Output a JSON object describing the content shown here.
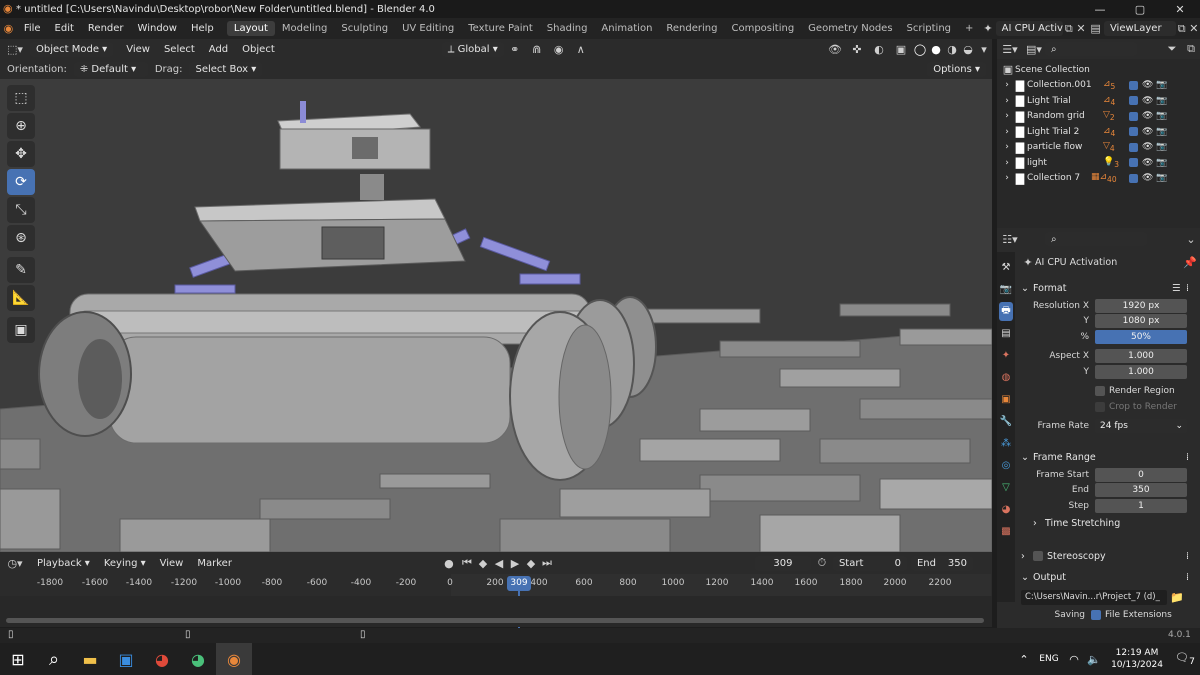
{
  "window": {
    "title": "* untitled [C:\\Users\\Navindu\\Desktop\\robor\\New Folder\\untitled.blend] - Blender 4.0",
    "controls": [
      "—",
      "▢",
      "✕"
    ]
  },
  "menu": {
    "items": [
      "File",
      "Edit",
      "Render",
      "Window",
      "Help"
    ],
    "workspaces": [
      "Layout",
      "Modeling",
      "Sculpting",
      "UV Editing",
      "Texture Paint",
      "Shading",
      "Animation",
      "Rendering",
      "Compositing",
      "Geometry Nodes",
      "Scripting"
    ],
    "active_workspace": "Layout",
    "add_workspace": "+",
    "scene_name": "AI CPU Activat",
    "view_layer": "ViewLayer"
  },
  "viewport": {
    "mode": "Object Mode",
    "menus": [
      "View",
      "Select",
      "Add",
      "Object"
    ],
    "transform_orientation": "Global",
    "orientation_label": "Orientation:",
    "orientation_value": "Default",
    "drag_label": "Drag:",
    "drag_value": "Select Box",
    "options_label": "Options"
  },
  "timeline": {
    "menus": [
      "Playback",
      "Keying",
      "View",
      "Marker"
    ],
    "current_frame": "309",
    "start_label": "Start",
    "start_value": "0",
    "end_label": "End",
    "end_value": "350",
    "ruler": [
      "-1800",
      "-1600",
      "-1400",
      "-1200",
      "-1000",
      "-800",
      "-600",
      "-400",
      "-200",
      "0",
      "200",
      "400",
      "600",
      "800",
      "1000",
      "1200",
      "1400",
      "1600",
      "1800",
      "2000",
      "2200"
    ],
    "playhead": "309"
  },
  "outliner": {
    "root": "Scene Collection",
    "items": [
      {
        "name": "Collection.001",
        "badge": "5"
      },
      {
        "name": "Light Trial",
        "badge": "4"
      },
      {
        "name": "Random grid",
        "badge": "2"
      },
      {
        "name": "Light Trial 2",
        "badge": "4"
      },
      {
        "name": "particle flow",
        "badge": "4"
      },
      {
        "name": "light",
        "badge": "3"
      },
      {
        "name": "Collection 7",
        "badge": "40"
      }
    ]
  },
  "properties": {
    "scene_name": "AI CPU Activation",
    "format": {
      "header": "Format",
      "resolution_x_label": "Resolution X",
      "resolution_x": "1920 px",
      "y_label": "Y",
      "resolution_y": "1080 px",
      "percent_label": "%",
      "percent": "50%",
      "aspect_x_label": "Aspect X",
      "aspect_x": "1.000",
      "aspect_y": "1.000",
      "render_region": "Render Region",
      "crop_to_render": "Crop to Render",
      "frame_rate_label": "Frame Rate",
      "frame_rate": "24 fps"
    },
    "frame_range": {
      "header": "Frame Range",
      "start_label": "Frame Start",
      "start": "0",
      "end_label": "End",
      "end": "350",
      "step_label": "Step",
      "step": "1"
    },
    "time_stretching": "Time Stretching",
    "stereoscopy": "Stereoscopy",
    "output": {
      "header": "Output",
      "path": "C:\\Users\\Navin...r\\Project_7 (d)_",
      "saving_label": "Saving",
      "file_extensions": "File Extensions"
    }
  },
  "status": {
    "version": "4.0.1"
  },
  "taskbar": {
    "lang": "ENG",
    "time": "12:19 AM",
    "date": "10/13/2024",
    "notifications": "7"
  },
  "colors": {
    "accent": "#4772b3",
    "viewport_bg": "#3d3d3d",
    "panel_bg": "#2b2b2b"
  }
}
